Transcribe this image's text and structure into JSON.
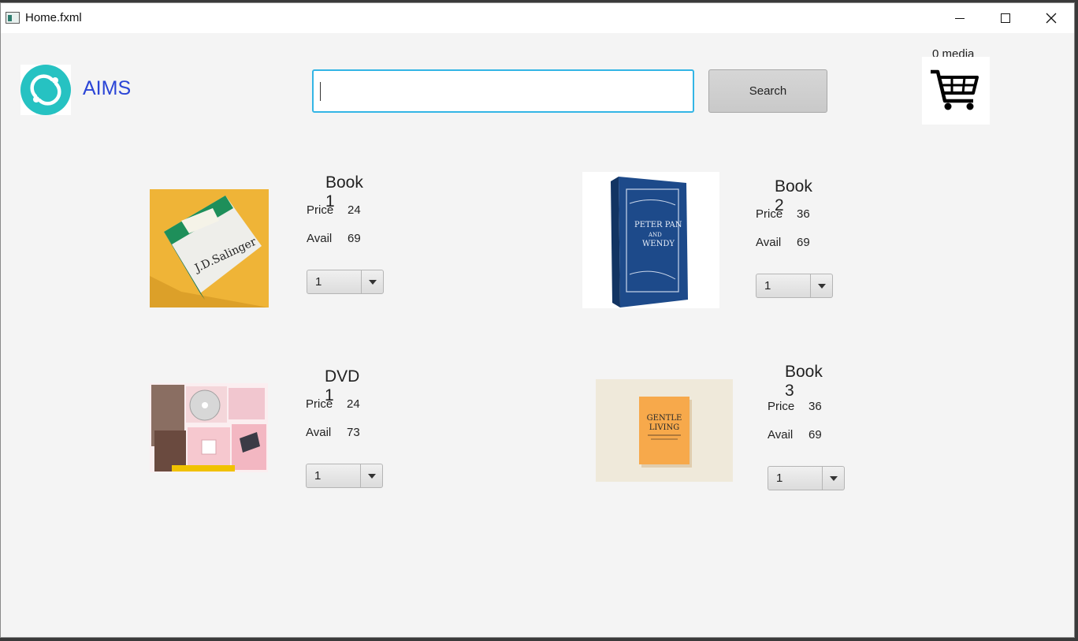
{
  "window": {
    "title": "Home.fxml"
  },
  "header": {
    "logo_label": "AIMS",
    "search": {
      "value": "",
      "placeholder": ""
    },
    "search_label": "Search",
    "cart_count": "0 media"
  },
  "items": [
    {
      "title": "Book 1",
      "price_label": "Price",
      "price": "24",
      "avail_label": "Avail",
      "avail": "69",
      "qty": "1",
      "image": "book-catcher-in-the-rye-cover"
    },
    {
      "title": "Book 2",
      "price_label": "Price",
      "price": "36",
      "avail_label": "Avail",
      "avail": "69",
      "qty": "1",
      "image": "book-peter-pan-cover"
    },
    {
      "title": "DVD 1",
      "price_label": "Price",
      "price": "24",
      "avail_label": "Avail",
      "avail": "73",
      "qty": "1",
      "image": "dvd-album-collage"
    },
    {
      "title": "Book 3",
      "price_label": "Price",
      "price": "36",
      "avail_label": "Avail",
      "avail": "69",
      "qty": "1",
      "image": "book-gentle-living-cover"
    }
  ],
  "colors": {
    "accent": "#33b5e5",
    "logo": "#26c2c2",
    "brand_text": "#2b45d6"
  }
}
